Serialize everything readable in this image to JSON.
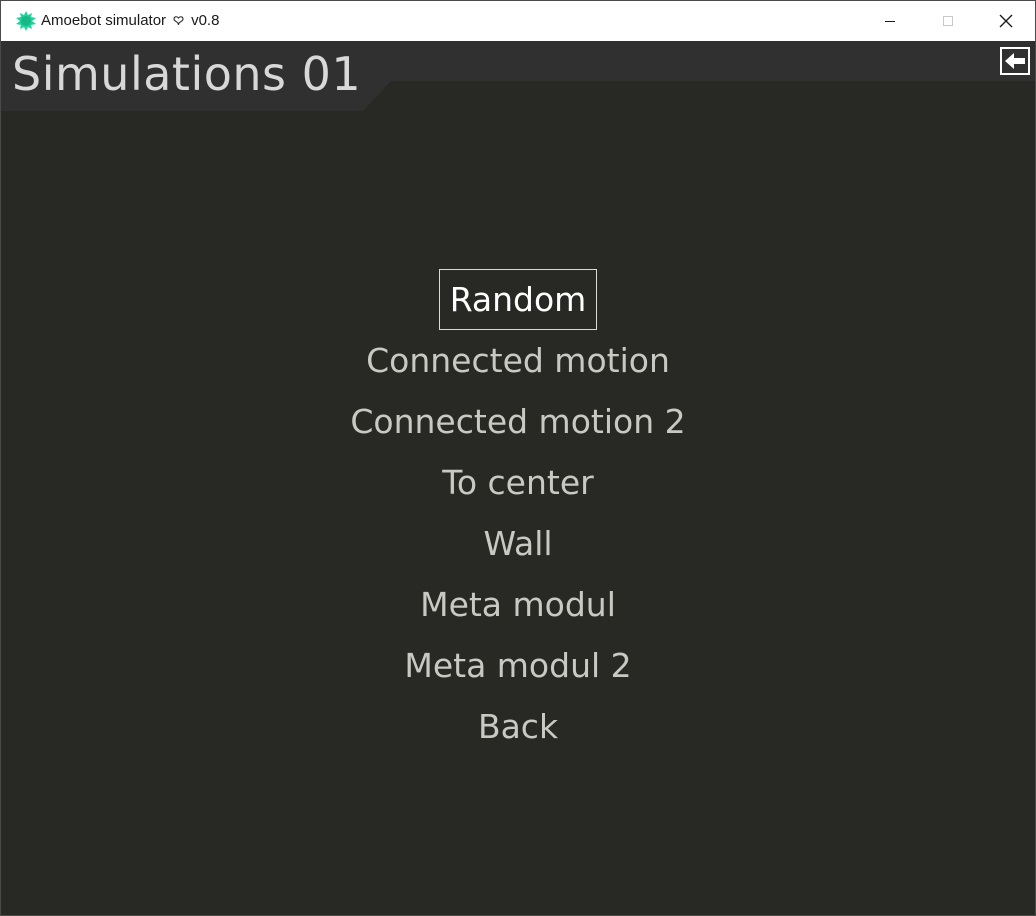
{
  "window": {
    "title": "Amoebot simulator",
    "title_glyph": "♠",
    "version": "v0.8"
  },
  "header": {
    "title": "Simulations 01",
    "back_icon": "arrow-left-icon"
  },
  "menu": {
    "items": [
      {
        "label": "Random",
        "selected": true
      },
      {
        "label": "Connected motion",
        "selected": false
      },
      {
        "label": "Connected motion 2",
        "selected": false
      },
      {
        "label": "To center",
        "selected": false
      },
      {
        "label": "Wall",
        "selected": false
      },
      {
        "label": "Meta modul",
        "selected": false
      },
      {
        "label": "Meta modul 2",
        "selected": false
      },
      {
        "label": "Back",
        "selected": false
      }
    ]
  },
  "colors": {
    "background": "#282824",
    "header": "#303030",
    "menu_text": "#c9c9c4",
    "selected_text": "#ffffff",
    "app_icon": "#1fd39a"
  }
}
